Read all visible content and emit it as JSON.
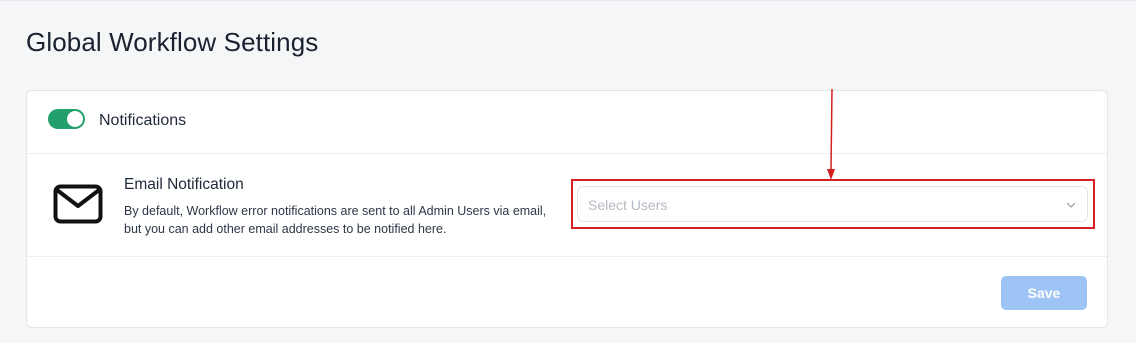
{
  "page": {
    "title": "Global Workflow Settings"
  },
  "notifications": {
    "toggle_on": true,
    "label": "Notifications"
  },
  "email": {
    "title": "Email Notification",
    "description": "By default, Workflow error notifications are sent to all Admin Users via email, but you can add other email addresses to be notified here.",
    "icon": "envelope-icon",
    "select": {
      "placeholder": "Select Users",
      "icon": "chevron-down-icon"
    }
  },
  "actions": {
    "save_label": "Save"
  },
  "colors": {
    "toggle_on": "#22a06b",
    "save_disabled": "#9ec4f5",
    "annotation": "#d42020"
  }
}
